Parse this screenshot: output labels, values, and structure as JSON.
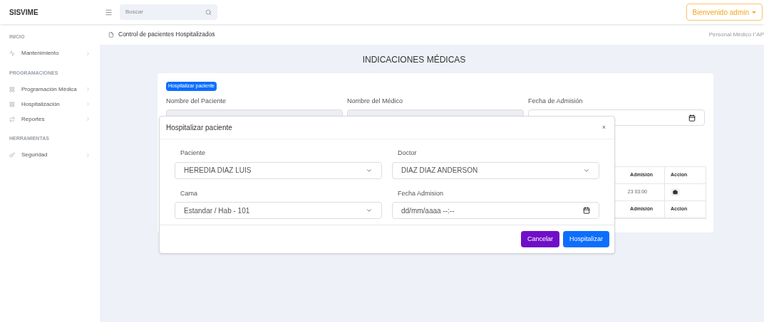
{
  "brand": "SISVIME",
  "search": {
    "placeholder": "Buscar"
  },
  "user_menu": "Bienvenido admin",
  "sidebar": [
    {
      "heading": "INICIO",
      "items": [
        {
          "label": "Mantenimiento",
          "kind": "pulse"
        }
      ]
    },
    {
      "heading": "PROGRAMACIONES",
      "items": [
        {
          "label": "Programación Médica",
          "kind": "grid"
        },
        {
          "label": "Hospitalización",
          "kind": "grid"
        },
        {
          "label": "Reportes",
          "kind": "repeat"
        }
      ]
    },
    {
      "heading": "HERRAMIENTAS",
      "items": [
        {
          "label": "Seguridad",
          "kind": "key"
        }
      ]
    }
  ],
  "breadcrumb": "Control de pacientes Hospitalizados",
  "breadcrumb_right": "Personal Médico I˜AP",
  "page_title": "INDICACIONES MÉDICAS",
  "card": {
    "badge": "Hospitalizar paciente",
    "fields": [
      {
        "label": "Nombre del Paciente",
        "kind": "text"
      },
      {
        "label": "Nombre del Médico",
        "kind": "text"
      },
      {
        "label": "Fecha de Admisión",
        "kind": "date"
      }
    ],
    "table": {
      "header_rows": [
        [
          "Admisión",
          "Accion"
        ],
        [
          "Admisión",
          "Accion"
        ]
      ],
      "rows": [
        [
          "23 03:00"
        ]
      ]
    }
  },
  "modal": {
    "title": "Hospitalizar paciente",
    "close": "×",
    "fields": [
      {
        "label": "Paciente",
        "kind": "select",
        "value": "HEREDIA DIAZ LUIS"
      },
      {
        "label": "Doctor",
        "kind": "select",
        "value": "DIAZ DIAZ ANDERSON"
      },
      {
        "label": "Cama",
        "kind": "select",
        "value": "Estandar / Hab - 101"
      },
      {
        "label": "Fecha Admision",
        "kind": "date",
        "placeholder": "dd/mm/aaaa --:--"
      }
    ],
    "buttons": [
      {
        "label": "Cancelar",
        "kind": "secondary"
      },
      {
        "label": "Hospitalizar",
        "kind": "primary"
      }
    ]
  }
}
